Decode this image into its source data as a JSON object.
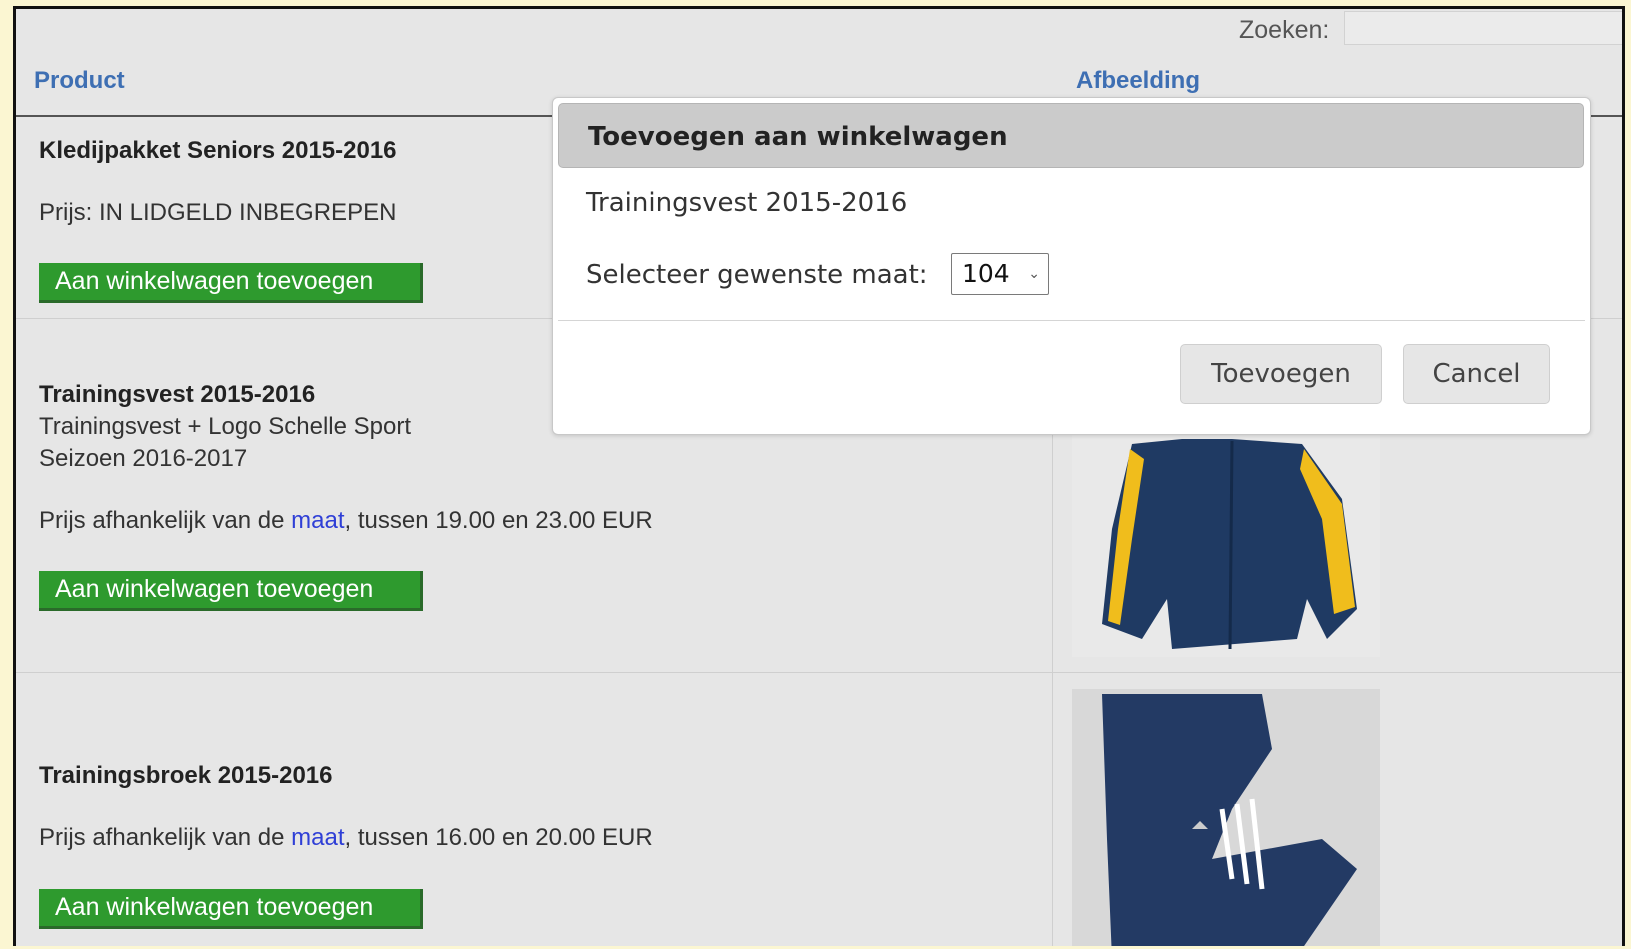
{
  "search": {
    "label": "Zoeken:",
    "value": ""
  },
  "table": {
    "col_product": "Product",
    "col_image": "Afbeelding"
  },
  "products": [
    {
      "title": "Kledijpakket Seniors 2015-2016",
      "price_text": "Prijs: IN LIDGELD INBEGREPEN",
      "button": "Aan winkelwagen toevoegen"
    },
    {
      "title": "Trainingsvest 2015-2016",
      "desc_line1": "Trainingsvest + Logo Schelle Sport",
      "desc_line2": "Seizoen 2016-2017",
      "price_prefix": "Prijs afhankelijk van de ",
      "price_link": "maat",
      "price_suffix": ", tussen 19.00 en 23.00 EUR",
      "button": "Aan winkelwagen toevoegen"
    },
    {
      "title": "Trainingsbroek 2015-2016",
      "price_prefix": "Prijs afhankelijk van de ",
      "price_link": "maat",
      "price_suffix": ", tussen 16.00 en 20.00 EUR",
      "button": "Aan winkelwagen toevoegen"
    }
  ],
  "modal": {
    "title": "Toevoegen aan winkelwagen",
    "product": "Trainingsvest 2015-2016",
    "size_label": "Selecteer gewenste maat:",
    "size_value": "104",
    "add_button": "Toevoegen",
    "cancel_button": "Cancel"
  },
  "colors": {
    "header_link": "#3e6fb3",
    "button_green": "#2e9a2e",
    "jacket_navy": "#1f3a63",
    "jacket_yellow": "#f0bd1c"
  }
}
